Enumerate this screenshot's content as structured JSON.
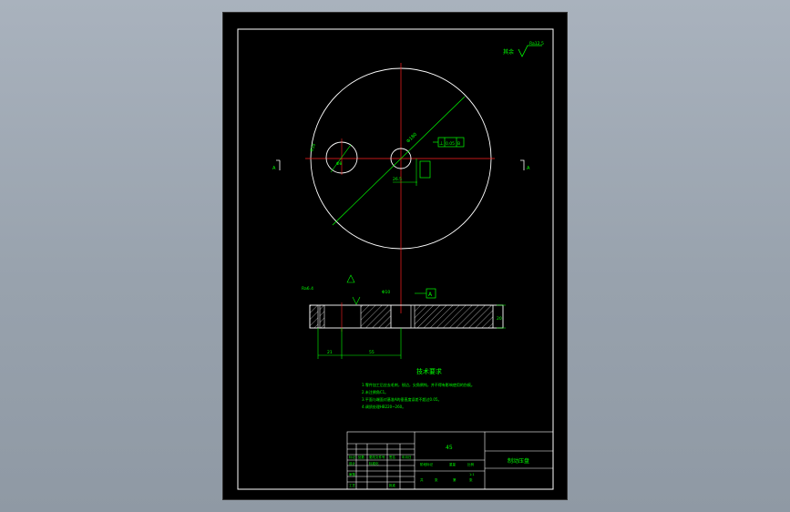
{
  "drawing": {
    "surface_finish": {
      "label": "其余",
      "value": "Ra12.5"
    },
    "section_marks": {
      "left": "A",
      "right": "A"
    },
    "datum_label": "A",
    "tolerance_frame": {
      "symbol": "⊥",
      "value": "0.05",
      "datum": "B"
    },
    "dims": {
      "hole_small": "Φ10",
      "hole_center": "Φ8",
      "diagonal": "Φ180",
      "center_offset": "26.5",
      "side_label": "Ra6.4",
      "depth": "20",
      "width_left": "21",
      "width_right": "55",
      "thickness": "20",
      "vert_small": "Φ10"
    },
    "tech": {
      "title": "技术要求",
      "notes": [
        "1.零件加工后应去毛刺，锐边，尖角倒钝，并不得有影响使用的伤痕。",
        "2.未注倒角C1。",
        "3.平面与端面对基准A的垂直度误差不超过0.05。",
        "4.调质处理HB220~260。"
      ]
    },
    "title_block": {
      "material": "45",
      "name": "制动压盘",
      "labels": [
        "标记",
        "处数",
        "分区",
        "更改文件号",
        "签名",
        "年月日",
        "设计",
        "标准化",
        "审核",
        "工艺",
        "批准"
      ],
      "stage": [
        "阶段标记",
        "重量",
        "比例"
      ],
      "scale": "1:1",
      "sheet": [
        "共",
        "张",
        "第",
        "张"
      ]
    }
  },
  "colors": {
    "line": "#ffffff",
    "dim": "#00ff00",
    "center": "#ff2020",
    "frame": "#ffffff"
  }
}
